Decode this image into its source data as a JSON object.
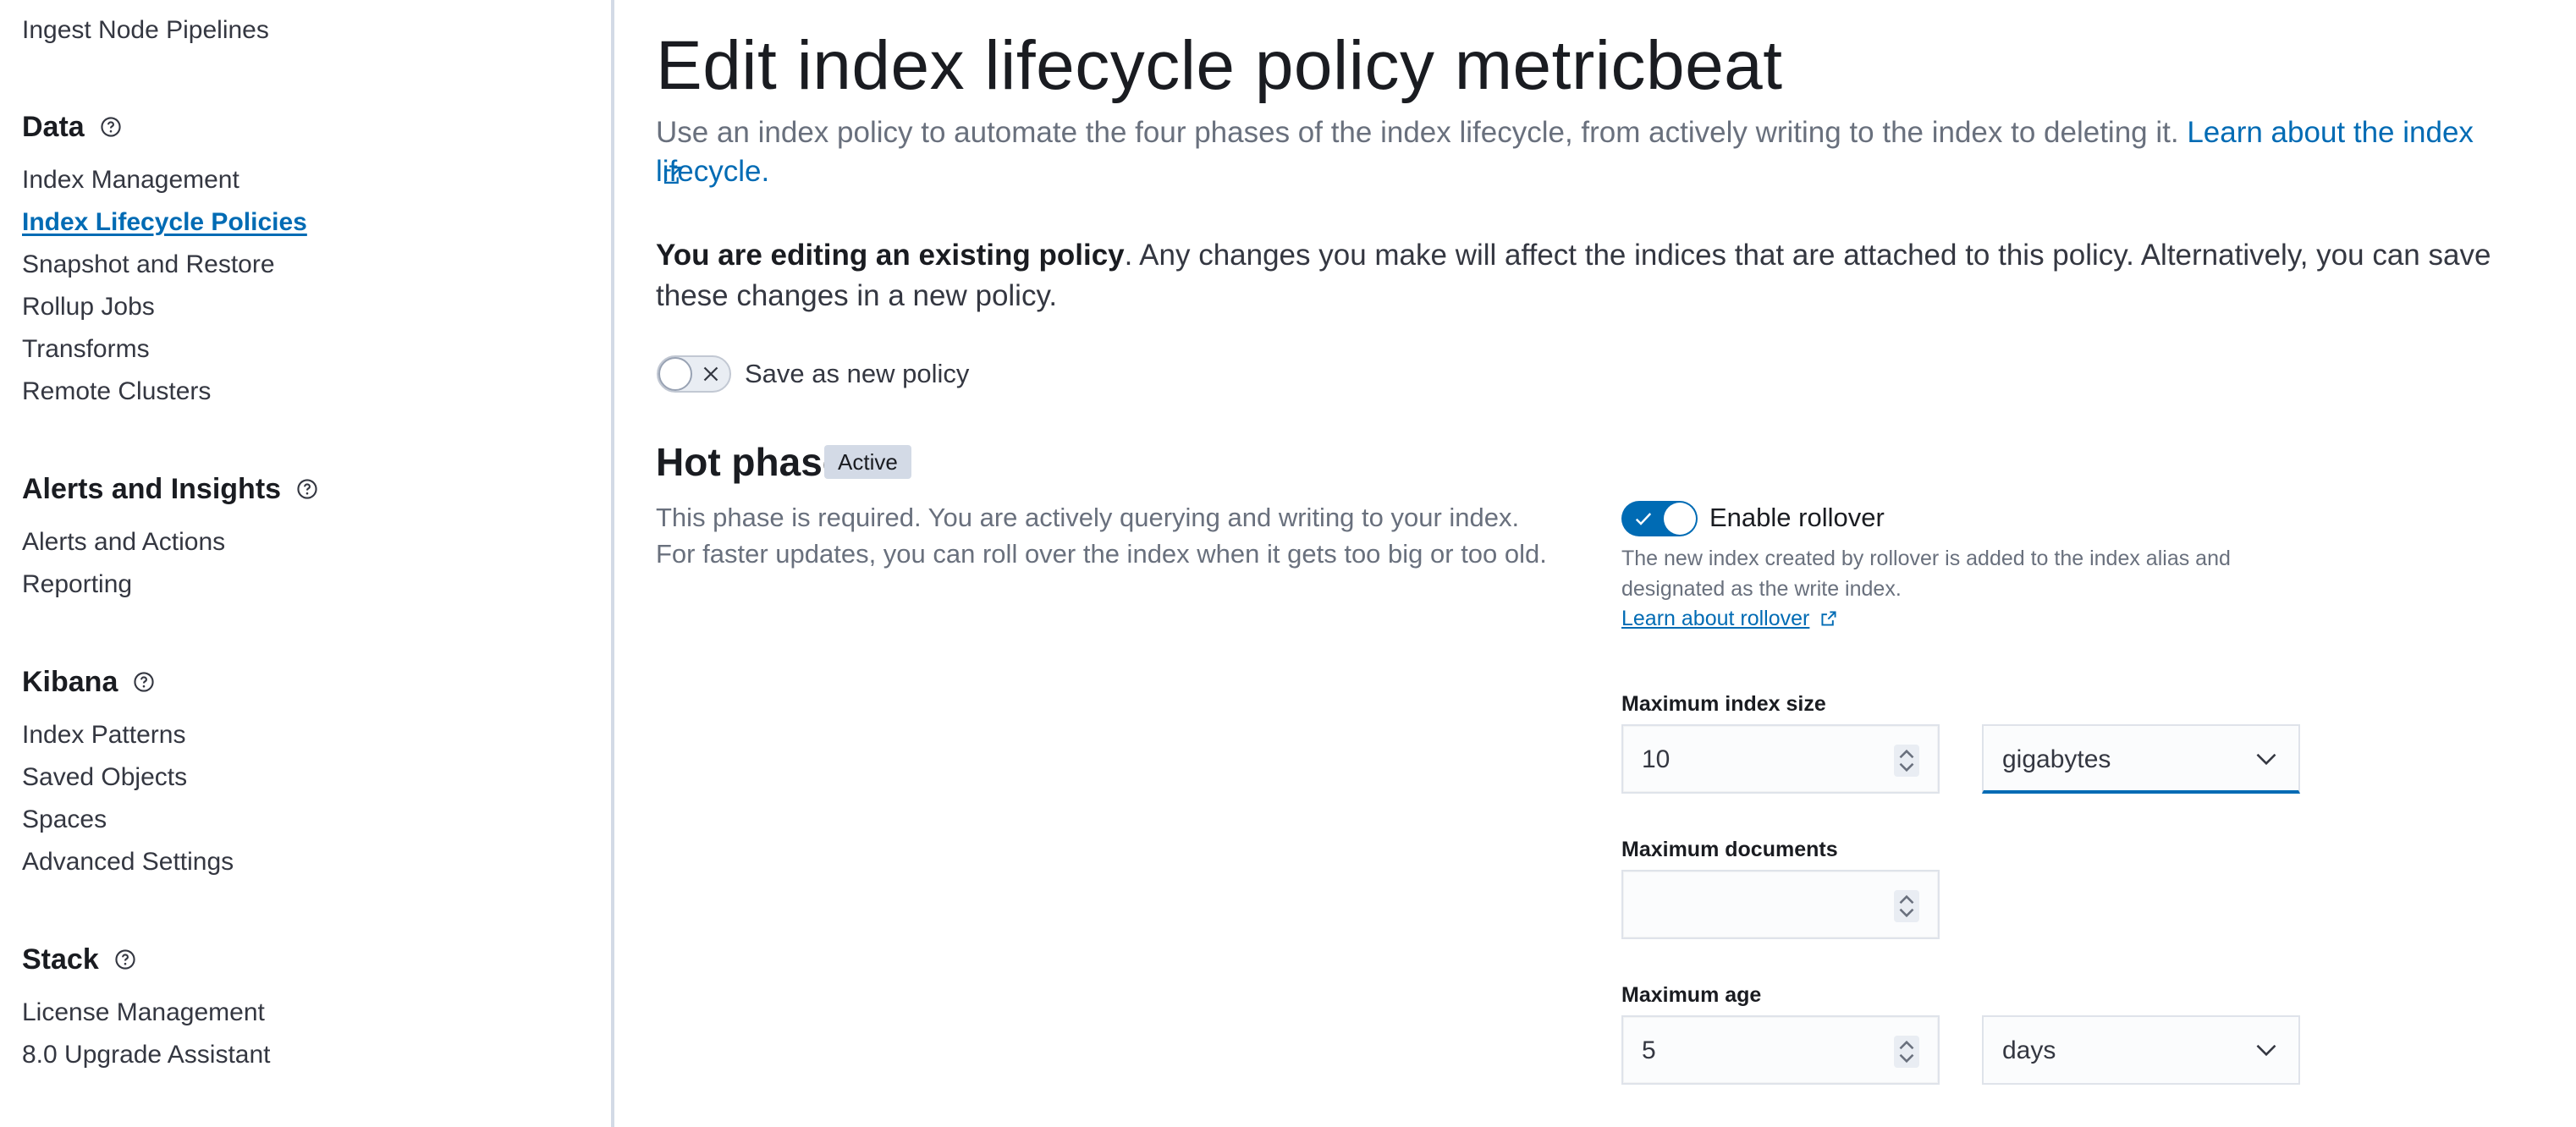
{
  "sidebar": {
    "top_item": "Ingest Node Pipelines",
    "sections": [
      {
        "heading": "Data",
        "items": [
          "Index Management",
          "Index Lifecycle Policies",
          "Snapshot and Restore",
          "Rollup Jobs",
          "Transforms",
          "Remote Clusters"
        ]
      },
      {
        "heading": "Alerts and Insights",
        "items": [
          "Alerts and Actions",
          "Reporting"
        ]
      },
      {
        "heading": "Kibana",
        "items": [
          "Index Patterns",
          "Saved Objects",
          "Spaces",
          "Advanced Settings"
        ]
      },
      {
        "heading": "Stack",
        "items": [
          "License Management",
          "8.0 Upgrade Assistant"
        ]
      }
    ],
    "active_item": "Index Lifecycle Policies"
  },
  "main": {
    "title": "Edit index lifecycle policy metricbeat",
    "description": "Use an index policy to automate the four phases of the index lifecycle, from actively writing to the index to deleting it.",
    "description_link": "Learn about the index lifecycle.",
    "callout_bold": "You are editing an existing policy",
    "callout_rest": ". Any changes you make will affect the indices that are attached to this policy. Alternatively, you can save these changes in a new policy.",
    "save_as_new_label": "Save as new policy",
    "hot_phase": {
      "title": "Hot phase",
      "badge": "Active",
      "description": "This phase is required. You are actively querying and writing to your index. For faster updates, you can roll over the index when it gets too big or too old.",
      "enable_rollover_label": "Enable rollover",
      "rollover_help": "The new index created by rollover is added to the index alias and designated as the write index.",
      "rollover_link": "Learn about rollover",
      "max_size_label": "Maximum index size",
      "max_size_value": "10",
      "max_size_unit": "gigabytes",
      "max_docs_label": "Maximum documents",
      "max_docs_value": "",
      "max_age_label": "Maximum age",
      "max_age_value": "5",
      "max_age_unit": "days"
    }
  },
  "icons": {
    "help": "question-circle-icon",
    "external": "external-link-icon",
    "toggle_off": "cross-icon",
    "toggle_on": "check-icon",
    "stepper": "stepper-icon",
    "dropdown": "chevron-down-icon"
  },
  "colors": {
    "link": "#006bb4",
    "toggle_on": "#006bb4",
    "badge_bg": "#d3dae6",
    "sidebar_border": "#d3dae6"
  }
}
